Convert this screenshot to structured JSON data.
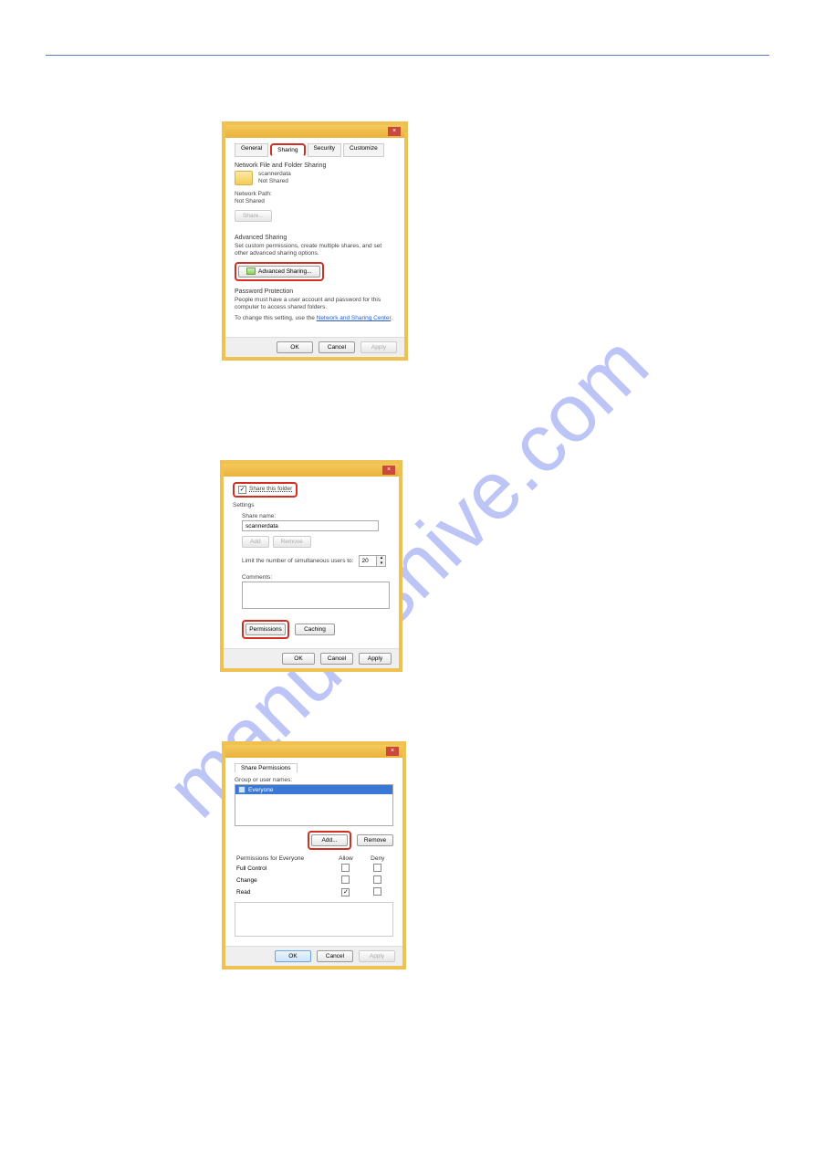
{
  "watermark": "manualshive.com",
  "dialog1": {
    "tabs": {
      "general": "General",
      "sharing": "Sharing",
      "security": "Security",
      "customize": "Customize"
    },
    "section_nfs_title": "Network File and Folder Sharing",
    "folder_name": "scannerdata",
    "folder_status": "Not Shared",
    "network_path_label": "Network Path:",
    "network_path_value": "Not Shared",
    "share_button": "Share...",
    "advanced_section_title": "Advanced Sharing",
    "advanced_section_text": "Set custom permissions, create multiple shares, and set other advanced sharing options.",
    "advanced_button": "Advanced Sharing...",
    "password_section_title": "Password Protection",
    "password_text": "People must have a user account and password for this computer to access shared folders.",
    "password_change_prefix": "To change this setting, use the",
    "password_link": "Network and Sharing Center",
    "ok": "OK",
    "cancel": "Cancel",
    "apply": "Apply"
  },
  "dialog2": {
    "share_checkbox_label": "Share this folder",
    "settings_label": "Settings",
    "share_name_label": "Share name:",
    "share_name_value": "scannerdata",
    "add": "Add",
    "remove": "Remove",
    "limit_label": "Limit the number of simultaneous users to:",
    "limit_value": "20",
    "comments_label": "Comments:",
    "permissions": "Permissions",
    "caching": "Caching",
    "ok": "OK",
    "cancel": "Cancel",
    "apply": "Apply"
  },
  "dialog3": {
    "tab": "Share Permissions",
    "group_label": "Group or user names:",
    "group_item": "Everyone",
    "add": "Add...",
    "remove": "Remove",
    "perm_header": "Permissions for Everyone",
    "col_allow": "Allow",
    "col_deny": "Deny",
    "rows": [
      "Full Control",
      "Change",
      "Read"
    ],
    "read_allow_checked": true,
    "ok": "OK",
    "cancel": "Cancel",
    "apply": "Apply"
  }
}
